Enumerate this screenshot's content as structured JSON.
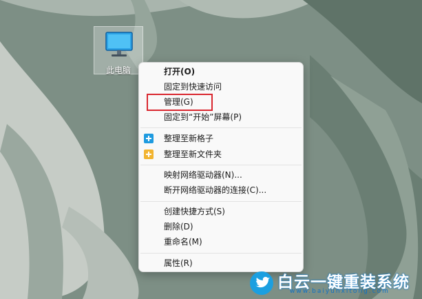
{
  "desktop": {
    "icon_label": "此电脑"
  },
  "context_menu": {
    "items": [
      {
        "label": "打开(O)"
      },
      {
        "label": "固定到快速访问"
      },
      {
        "label": "管理(G)"
      },
      {
        "label": "固定到“开始”屏幕(P)"
      },
      {
        "label": "整理至新格子"
      },
      {
        "label": "整理至新文件夹"
      },
      {
        "label": "映射网络驱动器(N)..."
      },
      {
        "label": "断开网络驱动器的连接(C)..."
      },
      {
        "label": "创建快捷方式(S)"
      },
      {
        "label": "删除(D)"
      },
      {
        "label": "重命名(M)"
      },
      {
        "label": "属性(R)"
      }
    ],
    "highlighted_item": "管理(G)"
  },
  "watermark": {
    "name": "白云一键重装系统",
    "url": "www.baiyunxitong.com"
  },
  "colors": {
    "highlight_box": "#d9262e",
    "new_grid_icon": "#1e9be0",
    "new_folder_icon": "#f2b430",
    "brand_blue": "#1b9fe0"
  },
  "icons": [
    "computer-icon",
    "new-grid-icon",
    "new-folder-icon",
    "twitter-bird-icon"
  ]
}
